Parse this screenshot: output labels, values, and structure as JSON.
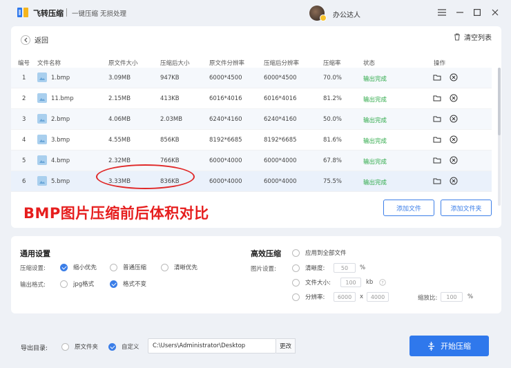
{
  "app": {
    "title": "飞转压缩",
    "slogan": "一键压缩 无损处理",
    "username": "办公达人"
  },
  "toolbar": {
    "back_label": "返回",
    "clear_label": "清空列表"
  },
  "table": {
    "headers": [
      "编号",
      "文件名称",
      "原文件大小",
      "压缩后大小",
      "原文件分辨率",
      "压缩后分辨率",
      "压缩率",
      "状态",
      "操作"
    ],
    "rows": [
      {
        "index": "1",
        "name": "1.bmp",
        "orig_size": "3.09MB",
        "new_size": "947KB",
        "orig_res": "6000*4500",
        "new_res": "6000*4500",
        "rate": "70.0%",
        "status": "输出完成"
      },
      {
        "index": "2",
        "name": "11.bmp",
        "orig_size": "2.15MB",
        "new_size": "413KB",
        "orig_res": "6016*4016",
        "new_res": "6016*4016",
        "rate": "81.2%",
        "status": "输出完成"
      },
      {
        "index": "3",
        "name": "2.bmp",
        "orig_size": "4.06MB",
        "new_size": "2.03MB",
        "orig_res": "6240*4160",
        "new_res": "6240*4160",
        "rate": "50.0%",
        "status": "输出完成"
      },
      {
        "index": "4",
        "name": "3.bmp",
        "orig_size": "4.55MB",
        "new_size": "856KB",
        "orig_res": "8192*6685",
        "new_res": "8192*6685",
        "rate": "81.6%",
        "status": "输出完成"
      },
      {
        "index": "5",
        "name": "4.bmp",
        "orig_size": "2.32MB",
        "new_size": "766KB",
        "orig_res": "6000*4000",
        "new_res": "6000*4000",
        "rate": "67.8%",
        "status": "输出完成"
      },
      {
        "index": "6",
        "name": "5.bmp",
        "orig_size": "3.33MB",
        "new_size": "836KB",
        "orig_res": "6000*4000",
        "new_res": "6000*4000",
        "rate": "75.5%",
        "status": "输出完成"
      }
    ]
  },
  "overlay_caption": "BMP图片压缩前后体积对比",
  "buttons": {
    "add_file": "添加文件",
    "add_folder": "添加文件夹",
    "start": "开始压缩",
    "change": "更改"
  },
  "general_settings": {
    "title": "通用设置",
    "compress_label": "压缩设置:",
    "compress_options": [
      "缩小优先",
      "普通压缩",
      "清晰优先"
    ],
    "compress_selected": "缩小优先",
    "format_label": "输出格式:",
    "format_options": [
      "jpg格式",
      "格式不变"
    ],
    "format_selected": "格式不变"
  },
  "advanced": {
    "title": "高效压缩",
    "apply_all": "应用到全部文件",
    "image_label": "图片设置:",
    "clarity_label": "清晰度:",
    "clarity_value": "50",
    "clarity_unit": "%",
    "size_label": "文件大小:",
    "size_value": "100",
    "size_unit": "kb",
    "resolution_label": "分辨率:",
    "res_w": "6000",
    "res_x": "x",
    "res_h": "4000",
    "scale_label": "缩放比:",
    "scale_value": "100",
    "scale_unit": "%"
  },
  "output": {
    "label": "导出目录:",
    "options": [
      "原文件夹",
      "自定义"
    ],
    "selected": "自定义",
    "path": "C:\\Users\\Administrator\\Desktop"
  },
  "colors": {
    "accent": "#2f78ec",
    "success": "#2faa4a",
    "annotation": "#e61e1e"
  }
}
